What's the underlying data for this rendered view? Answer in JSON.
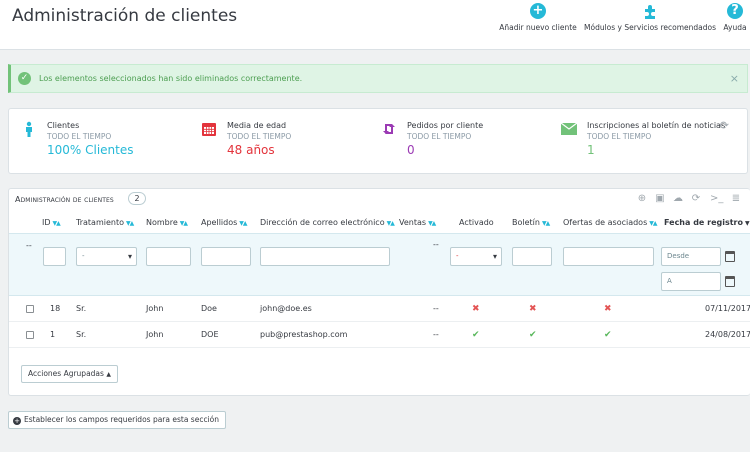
{
  "header": {
    "title": "Administración de clientes",
    "toolbar": [
      {
        "label": "Añadir nuevo cliente",
        "icon": "add-circle-icon"
      },
      {
        "label": "Módulos y Servicios recomendados",
        "icon": "puzzle-icon"
      },
      {
        "label": "Ayuda",
        "icon": "help-icon"
      }
    ]
  },
  "alert": {
    "message": "Los elementos seleccionados han sido eliminados correctamente.",
    "close": "×"
  },
  "kpis": [
    {
      "title": "Clientes",
      "subtitle": "TODO EL TIEMPO",
      "value": "100% Clientes",
      "color": "#25b9d7",
      "icon": "user-icon"
    },
    {
      "title": "Media de edad",
      "subtitle": "TODO EL TIEMPO",
      "value": "48 años",
      "color": "#e3343c",
      "icon": "calendar-icon"
    },
    {
      "title": "Pedidos por cliente",
      "subtitle": "TODO EL TIEMPO",
      "value": "0",
      "color": "#9b3ab4",
      "icon": "retweet-icon"
    },
    {
      "title": "Inscripciones al boletín de noticias",
      "subtitle": "TODO EL TIEMPO",
      "value": "1",
      "color": "#72c279",
      "icon": "envelope-icon"
    }
  ],
  "panel": {
    "title": "Administración de clientes",
    "count": "2",
    "columns": {
      "id": "ID",
      "social_title": "Tratamiento",
      "firstname": "Nombre",
      "lastname": "Apellidos",
      "email": "Dirección de correo electrónico",
      "sales": "Ventas",
      "active": "Activado",
      "newsletter": "Boletín",
      "optin": "Ofertas de asociados",
      "date_add": "Fecha de registro"
    },
    "filters": {
      "dash": "--",
      "social_select": "-",
      "active_select": "-",
      "sales_dash": "--",
      "date_from_placeholder": "Desde",
      "date_to_placeholder": "A"
    },
    "rows": [
      {
        "id": "18",
        "social": "Sr.",
        "firstname": "John",
        "lastname": "Doe",
        "email": "john@doe.es",
        "sales": "--",
        "active": "✖",
        "newsletter": "✖",
        "optin": "✖",
        "date": "07/11/2017"
      },
      {
        "id": "1",
        "social": "Sr.",
        "firstname": "John",
        "lastname": "DOE",
        "email": "pub@prestashop.com",
        "sales": "--",
        "active": "✔",
        "newsletter": "✔",
        "optin": "✔",
        "date": "24/08/2017"
      }
    ],
    "bulk_actions": "Acciones Agrupadas"
  },
  "required_fields_button": "Establecer los campos requeridos para esta sección"
}
